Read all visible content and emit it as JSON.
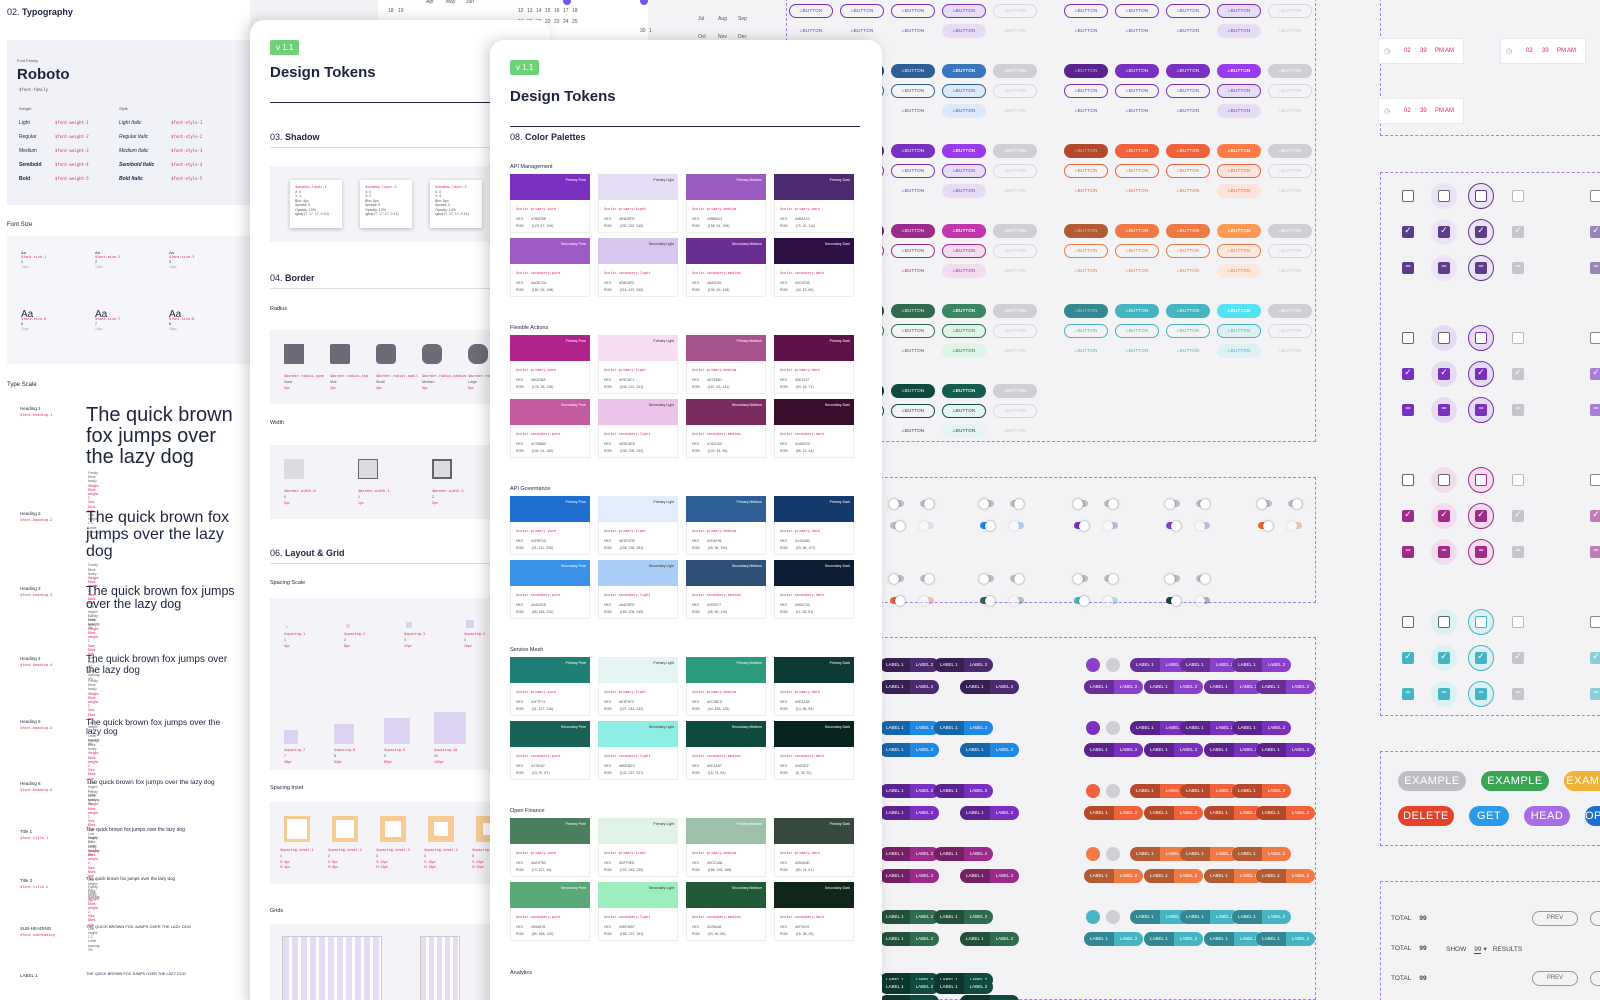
{
  "typography": {
    "section_num": "02.",
    "section_title": "Typography",
    "font_family_label": "Font Family",
    "font_family": "Roboto",
    "font_family_token": "$font-family",
    "weight_label": "Weight",
    "style_label": "Style",
    "weights": [
      {
        "name": "Light",
        "token": "$font-weight-1",
        "style": "Light Italic",
        "style_token": "$font-style-1"
      },
      {
        "name": "Regular",
        "token": "$font-weight-2",
        "style": "Regular Italic",
        "style_token": "$font-style-2"
      },
      {
        "name": "Medium",
        "token": "$font-weight-3",
        "style": "Medium Italic",
        "style_token": "$font-style-3"
      },
      {
        "name": "Semibold",
        "token": "$font-weight-4",
        "style": "Semibold Italic",
        "style_token": "$font-style-4"
      },
      {
        "name": "Bold",
        "token": "$font-weight-5",
        "style": "Bold Italic",
        "style_token": "$font-style-5"
      }
    ],
    "font_size_title": "Font Size",
    "font_sizes": [
      {
        "aa": "Aa",
        "token": "$font-size-1",
        "n": "1",
        "px": "10px"
      },
      {
        "aa": "Aa",
        "token": "$font-size-2",
        "n": "2",
        "px": "12px"
      },
      {
        "aa": "Aa",
        "token": "$font-size-3",
        "n": "3",
        "px": "14px"
      },
      {
        "aa": "Aa",
        "token": "$font-size-6",
        "n": "6",
        "px": "20px"
      },
      {
        "aa": "Aa",
        "token": "$font-size-7",
        "n": "7",
        "px": "24px"
      },
      {
        "aa": "Aa",
        "token": "$font-size-8",
        "n": "8",
        "px": "28px"
      }
    ],
    "type_scale_title": "Type Scale",
    "type_scale": [
      {
        "name": "Heading 1",
        "token": "$font-heading-1",
        "sample": "The quick brown fox jumps over the lazy dog"
      },
      {
        "name": "Heading 2",
        "token": "$font-heading-2",
        "sample": "The quick brown fox jumps over the lazy dog"
      },
      {
        "name": "Heading 3",
        "token": "$font-heading-3",
        "sample": "The quick brown fox jumps over the lazy dog"
      },
      {
        "name": "Heading 4",
        "token": "$font-heading-4",
        "sample": "The quick brown fox jumps over the lazy dog"
      },
      {
        "name": "Heading 5",
        "token": "$font-heading-5",
        "sample": "The quick brown fox jumps over the lazy dog"
      },
      {
        "name": "Heading 6",
        "token": "$font-heading-6",
        "sample": "The quick brown fox jumps over the lazy dog"
      },
      {
        "name": "Title 1",
        "token": "$font-title-1",
        "sample": "The quick brown fox jumps over the lazy dog"
      },
      {
        "name": "Title 2",
        "token": "$font-title-2",
        "sample": "The quick brown fox jumps over the lazy dog"
      },
      {
        "name": "SUB-HEADING",
        "token": "$font-subheading",
        "sample": "THE QUICK BROWN FOX JUMPS OVER THE LAZY DOG"
      },
      {
        "name": "LABEL 1",
        "token": "",
        "sample": "THE QUICK BROWN FOX JUMPS OVER THE LAZY DOG"
      }
    ],
    "meta_lines": [
      "Family: $font-family",
      "Weight: $font-weight-2",
      "Size: $font-size",
      "Line height: 1.2",
      "Letter spacing: 0%"
    ]
  },
  "card_back": {
    "version": "v 1.1",
    "title": "Design Tokens",
    "shadow_num": "03.",
    "shadow_title": "Shadow",
    "shadows": [
      {
        "token": "$shadow-layer-1",
        "lines": [
          "X: 0",
          "Y: 1",
          "Blur: 4px",
          "Spread: 0",
          "Opacity: 10%",
          "rgba(17, 17, 17, 0.10)"
        ]
      },
      {
        "token": "$shadow-layer-2",
        "lines": [
          "X: 0",
          "Y: 2",
          "Blur: 6px",
          "Spread: 0",
          "Opacity: 12%",
          "rgba(17, 17, 17, 0.12)"
        ]
      },
      {
        "token": "$shadow-layer-3",
        "lines": [
          "X: 0",
          "Y: 4",
          "Blur: 8px",
          "Spread: 0",
          "Opacity: 14%",
          "rgba(17, 17, 17, 0.14)"
        ]
      },
      {
        "token": "$shadow-layer-4",
        "lines": [
          "X: 0",
          "Y: 6",
          "Blur: 12px",
          "Spread: 0",
          "Opacity: 16%",
          "rgba(17, 17, 17, 0.16)"
        ]
      }
    ],
    "border_num": "04.",
    "border_title": "Border",
    "radius_label": "Radius",
    "radii": [
      {
        "token": "$border-radius-none",
        "name": "None",
        "px": "0px"
      },
      {
        "token": "$border-radius-xsm",
        "name": "Mini",
        "px": "2px"
      },
      {
        "token": "$border-radius-small",
        "name": "Small",
        "px": "4px"
      },
      {
        "token": "$border-radius-medium",
        "name": "Medium",
        "px": "6px"
      },
      {
        "token": "$border-radius-large",
        "name": "Large",
        "px": "8px"
      }
    ],
    "width_label": "Width",
    "widths": [
      {
        "token": "$border-width-0",
        "n": "0",
        "px": "0px"
      },
      {
        "token": "$border-width-1",
        "n": "1",
        "px": "1px"
      },
      {
        "token": "$border-width-2",
        "n": "2",
        "px": "2px"
      }
    ],
    "layout_num": "06.",
    "layout_title": "Layout & Grid",
    "spacing_scale_label": "Spacing Scale",
    "spacing_top": [
      {
        "token": "$spacing-1",
        "n": "1",
        "px": "4px"
      },
      {
        "token": "$spacing-2",
        "n": "2",
        "px": "8px"
      },
      {
        "token": "$spacing-3",
        "n": "3",
        "px": "12px"
      },
      {
        "token": "$spacing-4",
        "n": "4",
        "px": "16px"
      }
    ],
    "spacing_bottom": [
      {
        "token": "$spacing-7",
        "n": "7",
        "px": "48px"
      },
      {
        "token": "$spacing-8",
        "n": "8",
        "px": "64px"
      },
      {
        "token": "$spacing-9",
        "n": "9",
        "px": "80px"
      },
      {
        "token": "$spacing-10",
        "n": "10",
        "px": "100px"
      }
    ],
    "spacing_inset_label": "Spacing Inset",
    "insets": [
      {
        "token": "$spacing-inset-1",
        "n": "1",
        "v": "V: 4px",
        "h": "H: 4px"
      },
      {
        "token": "$spacing-inset-2",
        "n": "2",
        "v": "V: 8px",
        "h": "H: 8px"
      },
      {
        "token": "$spacing-inset-3",
        "n": "3",
        "v": "V: 12px",
        "h": "H: 12px"
      },
      {
        "token": "$spacing-inset-4",
        "n": "4",
        "v": "V: 16px",
        "h": "H: 16px"
      },
      {
        "token": "$spacing-inset-5",
        "n": "5",
        "v": "V: 20px",
        "h": "H: 20px"
      }
    ],
    "grids_label": "Grids"
  },
  "card_front": {
    "version": "v 1.1",
    "title": "Design Tokens",
    "section_num": "08.",
    "section_title": "Color Palettes",
    "hex_label": "HEX",
    "rgb_label": "RGB",
    "palettes": [
      {
        "name": "API Management",
        "rows": [
          [
            {
              "n": "Primary Pure",
              "t": "$color-primary-pure",
              "hex": "#7B2FBE",
              "rgb": "(123, 47, 190)",
              "c": "#7b2fbe"
            },
            {
              "n": "Primary Light",
              "t": "$color-primary-light",
              "hex": "#E6DEF5",
              "rgb": "(230, 222, 245)",
              "c": "#e6def5",
              "l": 1
            },
            {
              "n": "Primary Medium",
              "t": "$color-primary-medium",
              "hex": "#9B5BC3",
              "rgb": "(155, 91, 195)",
              "c": "#9b5bc3"
            },
            {
              "n": "Primary Dark",
              "t": "$color-primary-dark",
              "hex": "#4B2A70",
              "rgb": "(75, 42, 112)",
              "c": "#4b2a70"
            }
          ],
          [
            {
              "n": "Secondary Pure",
              "t": "$color-secondary-pure",
              "hex": "#A05CC6",
              "rgb": "(160, 92, 198)",
              "c": "#a05cc6"
            },
            {
              "n": "Secondary Light",
              "t": "$color-secondary-light",
              "hex": "#D8C5F0",
              "rgb": "(216, 197, 240)",
              "c": "#d8c5f0",
              "l": 1
            },
            {
              "n": "Secondary Medium",
              "t": "$color-secondary-medium",
              "hex": "#6A2D91",
              "rgb": "(106, 45, 145)",
              "c": "#6a2d91"
            },
            {
              "n": "Secondary Dark",
              "t": "$color-secondary-dark",
              "hex": "#2C0F45",
              "rgb": "(44, 15, 69)",
              "c": "#2c0f45"
            }
          ]
        ]
      },
      {
        "name": "Flexible Actions",
        "rows": [
          [
            {
              "n": "Primary Pure",
              "t": "$color-primary-pure",
              "hex": "#B0238A",
              "rgb": "(176, 35, 138)",
              "c": "#b0238a"
            },
            {
              "n": "Primary Light",
              "t": "$color-primary-light",
              "hex": "#F6DDF1",
              "rgb": "(246, 221, 241)",
              "c": "#f6ddf1",
              "l": 1
            },
            {
              "n": "Primary Medium",
              "t": "$color-primary-medium",
              "hex": "#A7538D",
              "rgb": "(167, 83, 141)",
              "c": "#a7538d"
            },
            {
              "n": "Primary Dark",
              "t": "$color-primary-dark",
              "hex": "#5E1247",
              "rgb": "(94, 18, 71)",
              "c": "#5e1247"
            }
          ],
          [
            {
              "n": "Secondary Pure",
              "t": "$color-secondary-pure",
              "hex": "#C25BA0",
              "rgb": "(194, 91, 160)",
              "c": "#c25ba0"
            },
            {
              "n": "Secondary Light",
              "t": "$color-secondary-light",
              "hex": "#EBC3E8",
              "rgb": "(235, 195, 232)",
              "c": "#ebc3e8",
              "l": 1
            },
            {
              "n": "Secondary Medium",
              "t": "$color-secondary-medium",
              "hex": "#7A2C60",
              "rgb": "(122, 44, 96)",
              "c": "#7a2c60"
            },
            {
              "n": "Secondary Dark",
              "t": "$color-secondary-dark",
              "hex": "#3A0D2C",
              "rgb": "(58, 13, 44)",
              "c": "#3a0d2c"
            }
          ]
        ]
      },
      {
        "name": "API Governance",
        "rows": [
          [
            {
              "n": "Primary Pure",
              "t": "$color-primary-pure",
              "hex": "#1F6FD0",
              "rgb": "(31, 111, 208)",
              "c": "#1f6fd0"
            },
            {
              "n": "Primary Light",
              "t": "$color-primary-light",
              "hex": "#E2ECFB",
              "rgb": "(226, 236, 251)",
              "c": "#e2ecfb",
              "l": 1
            },
            {
              "n": "Primary Medium",
              "t": "$color-primary-medium",
              "hex": "#2D5F96",
              "rgb": "(45, 95, 150)",
              "c": "#2d5f96"
            },
            {
              "n": "Primary Dark",
              "t": "$color-primary-dark",
              "hex": "#143A6B",
              "rgb": "(20, 58, 107)",
              "c": "#143a6b"
            }
          ],
          [
            {
              "n": "Secondary Pure",
              "t": "$color-secondary-pure",
              "hex": "#3A92E8",
              "rgb": "(58, 146, 232)",
              "c": "#3a92e8"
            },
            {
              "n": "Secondary Light",
              "t": "$color-secondary-light",
              "hex": "#A9CEF5",
              "rgb": "(169, 206, 245)",
              "c": "#a9cef5",
              "l": 1
            },
            {
              "n": "Secondary Medium",
              "t": "$color-secondary-medium",
              "hex": "#2E5077",
              "rgb": "(46, 80, 119)",
              "c": "#2e5077"
            },
            {
              "n": "Secondary Dark",
              "t": "$color-secondary-dark",
              "hex": "#0B1C33",
              "rgb": "(11, 28, 51)",
              "c": "#0b1c33"
            }
          ]
        ]
      },
      {
        "name": "Service Mesh",
        "rows": [
          [
            {
              "n": "Primary Pure",
              "t": "$color-primary-pure",
              "hex": "#1F7F74",
              "rgb": "(31, 127, 116)",
              "c": "#1f7f74"
            },
            {
              "n": "Primary Light",
              "t": "$color-primary-light",
              "hex": "#E3F4F2",
              "rgb": "(227, 244, 242)",
              "c": "#e3f4f2",
              "l": 1
            },
            {
              "n": "Primary Medium",
              "t": "$color-primary-medium",
              "hex": "#2C9B7D",
              "rgb": "(44, 155, 125)",
              "c": "#2c9b7d"
            },
            {
              "n": "Primary Dark",
              "t": "$color-primary-dark",
              "hex": "#0E3A35",
              "rgb": "(14, 58, 53)",
              "c": "#0e3a35"
            }
          ],
          [
            {
              "n": "Secondary Pure",
              "t": "$color-secondary-pure",
              "hex": "#176157",
              "rgb": "(23, 97, 87)",
              "c": "#176157"
            },
            {
              "n": "Secondary Light",
              "t": "$color-secondary-light",
              "hex": "#8EEDE3",
              "rgb": "(142, 237, 227)",
              "c": "#8eede3",
              "l": 1
            },
            {
              "n": "Secondary Medium",
              "t": "$color-secondary-medium",
              "hex": "#0F4A3F",
              "rgb": "(15, 74, 63)",
              "c": "#0f4a3f"
            },
            {
              "n": "Secondary Dark",
              "t": "$color-secondary-dark",
              "hex": "#06231F",
              "rgb": "(6, 35, 31)",
              "c": "#06231f"
            }
          ]
        ]
      },
      {
        "name": "Open Finance",
        "rows": [
          [
            {
              "n": "Primary Pure",
              "t": "$color-primary-pure",
              "hex": "#4A7F5E",
              "rgb": "(74, 127, 94)",
              "c": "#4a7f5e"
            },
            {
              "n": "Primary Light",
              "t": "$color-primary-light",
              "hex": "#DFF3E6",
              "rgb": "(223, 243, 230)",
              "c": "#dff3e6",
              "l": 1
            },
            {
              "n": "Primary Medium",
              "t": "$color-primary-medium",
              "hex": "#9CC1A8",
              "rgb": "(156, 193, 168)",
              "c": "#9cc1a8"
            },
            {
              "n": "Primary Dark",
              "t": "$color-primary-dark",
              "hex": "#354A3D",
              "rgb": "(53, 74, 61)",
              "c": "#354a3d"
            }
          ],
          [
            {
              "n": "Secondary Pure",
              "t": "$color-secondary-pure",
              "hex": "#59A878",
              "rgb": "(89, 168, 120)",
              "c": "#59a878"
            },
            {
              "n": "Secondary Light",
              "t": "$color-secondary-light",
              "hex": "#9EEDBF",
              "rgb": "(158, 237, 191)",
              "c": "#9eedbf",
              "l": 1
            },
            {
              "n": "Secondary Medium",
              "t": "$color-secondary-medium",
              "hex": "#225A38",
              "rgb": "(34, 90, 56)",
              "c": "#225a38"
            },
            {
              "n": "Secondary Dark",
              "t": "$color-secondary-dark",
              "hex": "#0F2619",
              "rgb": "(15, 38, 25)",
              "c": "#0f2619"
            }
          ]
        ]
      }
    ],
    "next_palette": "Analytics"
  },
  "components": {
    "button_label": "BUTTON",
    "segment_label_1": "LABEL 1",
    "segment_label_2": "LABEL 2",
    "time": {
      "h": "02",
      "m": "39",
      "pm": "PM",
      "am": "AM"
    },
    "tags": [
      "EXAMPLE",
      "EXAMPLE",
      "EXAMPLE",
      "DELETE",
      "GET",
      "HEAD",
      "OPTIONS"
    ],
    "pagination": {
      "total_label": "TOTAL",
      "total": "99",
      "show_label": "SHOW",
      "show_value": "99",
      "results_label": "RESULTS",
      "prev": "PREV",
      "next": "NEXT"
    },
    "calendar": {
      "months": [
        "Apr",
        "May",
        "Jun",
        "Jul",
        "Aug",
        "Sep",
        "Oct",
        "Nov",
        "Dec"
      ],
      "row1": [
        "18",
        "19"
      ],
      "row2": [
        "12",
        "13",
        "14",
        "15",
        "16",
        "17",
        "18"
      ],
      "row3": [
        "19",
        "20",
        "21",
        "22",
        "23",
        "24",
        "25"
      ],
      "row4": [
        "30",
        "1"
      ]
    }
  },
  "colors": {
    "purple": "#7b2fbe",
    "dkpurple": "#4b2a70",
    "blue": "#1e88e5",
    "magenta": "#9b2b8a",
    "green": "#2e6b4f",
    "dkgreen": "#0f4a3f",
    "orange": "#f0623a",
    "coral": "#ef7a45",
    "teal": "#45b5c4",
    "grey": "#cfcfd4",
    "accent": "#a97de9"
  }
}
